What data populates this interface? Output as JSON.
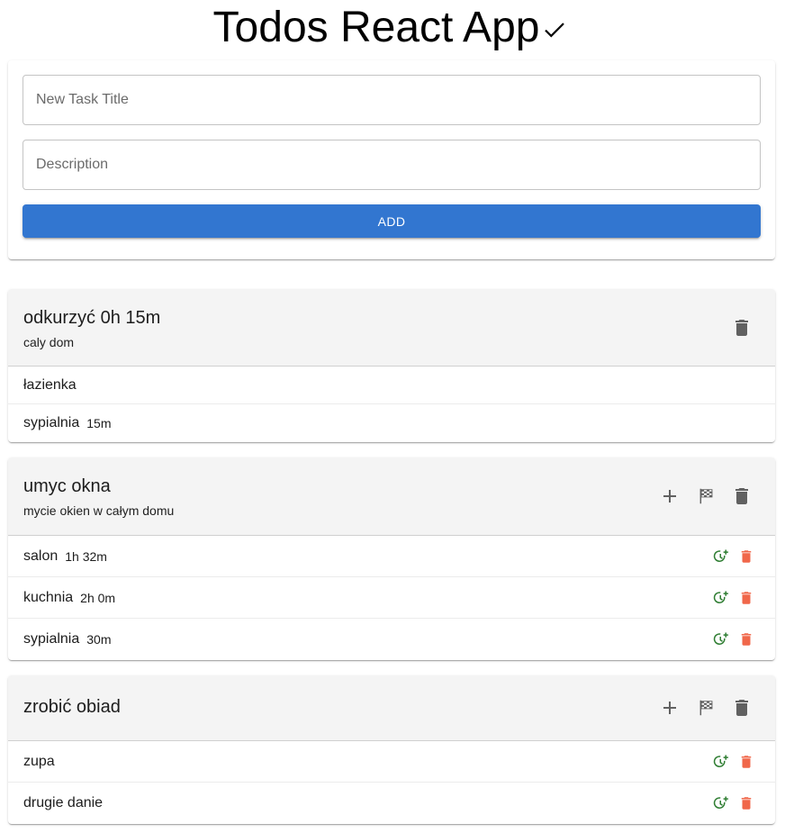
{
  "app": {
    "title": "Todos React App"
  },
  "form": {
    "title_placeholder": "New Task Title",
    "description_placeholder": "Description",
    "add_label": "ADD"
  },
  "colors": {
    "accent": "#3276d0",
    "timer": "#2e7d32",
    "delete_sub": "#f0674a",
    "icon_grey": "#616161"
  },
  "tasks": [
    {
      "title": "odkurzyć 0h 15m",
      "description": "caly dom",
      "subtasks": [
        {
          "name": "łazienka",
          "time": ""
        },
        {
          "name": "sypialnia",
          "time": "15m"
        }
      ]
    },
    {
      "title": "umyc okna",
      "description": "mycie okien w całym domu",
      "subtasks": [
        {
          "name": "salon",
          "time": "1h 32m"
        },
        {
          "name": "kuchnia",
          "time": "2h 0m"
        },
        {
          "name": "sypialnia",
          "time": "30m"
        }
      ]
    },
    {
      "title": "zrobić obiad",
      "description": "",
      "subtasks": [
        {
          "name": "zupa",
          "time": ""
        },
        {
          "name": "drugie danie",
          "time": ""
        }
      ]
    }
  ]
}
